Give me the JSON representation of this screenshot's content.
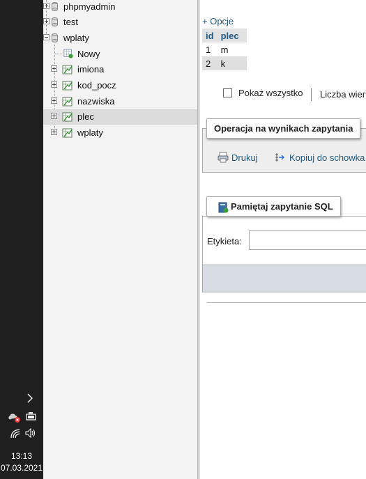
{
  "taskbar": {
    "time": "13:13",
    "date": "07.03.2021"
  },
  "nav": {
    "databases": [
      "phpmyadmin",
      "test",
      "wplaty"
    ],
    "new_label": "Nowy",
    "tables": [
      "imiona",
      "kod_pocz",
      "nazwiska",
      "plec",
      "wplaty"
    ],
    "selected_table": "plec"
  },
  "main": {
    "options_link": "+ Opcje",
    "columns": [
      "id",
      "plec"
    ],
    "rows": [
      [
        "1",
        "m"
      ],
      [
        "2",
        "k"
      ]
    ],
    "show_all_label": "Pokaż wszystko",
    "rows_count_label": "Liczba wier",
    "ops_legend": "Operacja na wynikach zapytania",
    "print_label": "Drukuj",
    "copy_label": "Kopiuj do schowka",
    "bookmark_legend": "Pamiętaj zapytanie SQL",
    "label_field_label": "Etykieta:",
    "label_field_value": ""
  },
  "colors": {
    "link": "#235a81",
    "taskbar": "#1f1f1f",
    "nav_bg": "#f3f3f3"
  }
}
